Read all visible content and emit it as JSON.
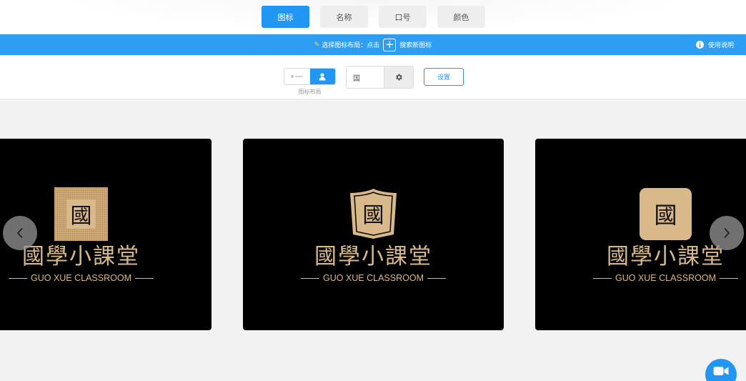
{
  "tabs": [
    {
      "label": "图标",
      "active": true
    },
    {
      "label": "名称",
      "active": false
    },
    {
      "label": "口号",
      "active": false
    },
    {
      "label": "颜色",
      "active": false
    }
  ],
  "hint_bar": {
    "prefix": "选择图标布局：点击",
    "plus_symbol": "+",
    "suffix": "搜索新图标",
    "help_label": "使用说明",
    "info_symbol": "i"
  },
  "toolbar": {
    "layout_label": "图标布局",
    "color_input_value": "国",
    "settings_label": "设置"
  },
  "cards": [
    {
      "emblem_char": "國",
      "emblem_style": "square-seal",
      "brand_cn": "國學小課堂",
      "brand_en": "GUO XUE CLASSROOM"
    },
    {
      "emblem_char": "國",
      "emblem_style": "shield",
      "brand_cn": "國學小課堂",
      "brand_en": "GUO XUE CLASSROOM"
    },
    {
      "emblem_char": "國",
      "emblem_style": "rounded-square",
      "brand_cn": "國學小課堂",
      "brand_en": "GUO XUE CLASSROOM"
    }
  ],
  "colors": {
    "accent": "#2196f3",
    "strip": "#2e9ef4",
    "gold": "#d9b98a",
    "card_bg": "#000000"
  },
  "icons": {
    "gear": "gear-icon",
    "prev": "chevron-left-icon",
    "next": "chevron-right-icon",
    "video": "video-camera-icon"
  }
}
